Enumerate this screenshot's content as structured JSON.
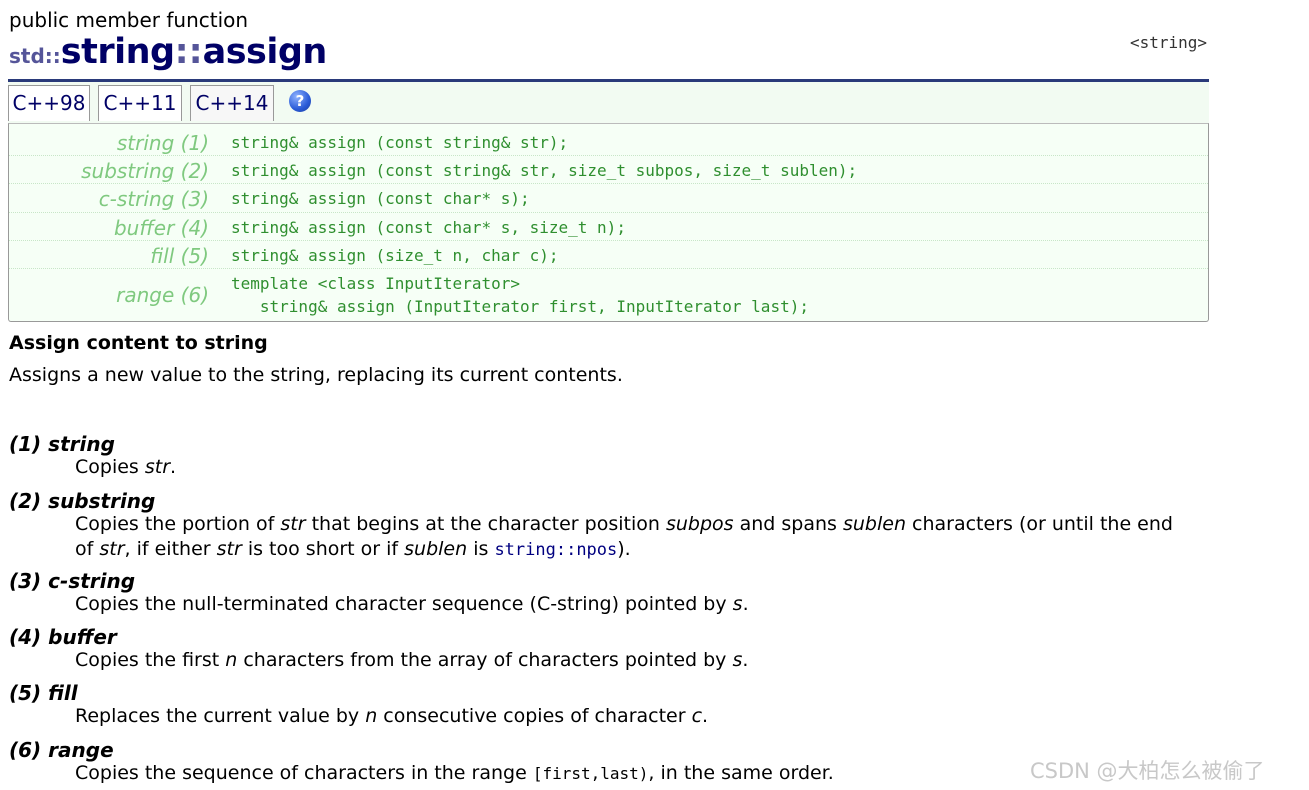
{
  "page": {
    "kind": "public member function",
    "title": {
      "ns": "std::",
      "cls": "string",
      "sep": "::",
      "fn": "assign"
    },
    "header_link": "<string>"
  },
  "tabs": [
    {
      "label": "C++98"
    },
    {
      "label": "C++11"
    },
    {
      "label": "C++14"
    }
  ],
  "help": {
    "glyph": "?"
  },
  "declarations": [
    {
      "label": "string (1)",
      "code": "string& assign (const string& str);"
    },
    {
      "label": "substring (2)",
      "code": "string& assign (const string& str, size_t subpos, size_t sublen);"
    },
    {
      "label": "c-string (3)",
      "code": "string& assign (const char* s);"
    },
    {
      "label": "buffer (4)",
      "code": "string& assign (const char* s, size_t n);"
    },
    {
      "label": "fill (5)",
      "code": "string& assign (size_t n, char c);"
    },
    {
      "label": "range (6)",
      "code": "template <class InputIterator>\n   string& assign (InputIterator first, InputIterator last);"
    }
  ],
  "section": {
    "heading": "Assign content to string",
    "description": "Assigns a new value to the string, replacing its current contents."
  },
  "items": {
    "i1": {
      "head": "(1) string",
      "t1": "Copies ",
      "p1": "str",
      "t2": "."
    },
    "i2": {
      "head": "(2) substring",
      "t1": "Copies the portion of ",
      "p1": "str",
      "t2": " that begins at the character position ",
      "p2": "subpos",
      "t3": " and spans ",
      "p3": "sublen",
      "t4": " characters (or until the end of ",
      "p4": "str",
      "t5": ", if either ",
      "p5": "str",
      "t6": " is too short or if ",
      "p6": "sublen",
      "t7": " is ",
      "link": "string::npos",
      "t8": ")."
    },
    "i3": {
      "head": "(3) c-string",
      "t1": "Copies the null-terminated character sequence (C-string) pointed by ",
      "p1": "s",
      "t2": "."
    },
    "i4": {
      "head": "(4) buffer",
      "t1": "Copies the first ",
      "p1": "n",
      "t2": " characters from the array of characters pointed by ",
      "p2": "s",
      "t3": "."
    },
    "i5": {
      "head": "(5) fill",
      "t1": "Replaces the current value by ",
      "p1": "n",
      "t2": " consecutive copies of character ",
      "p2": "c",
      "t3": "."
    },
    "i6": {
      "head": "(6) range",
      "t1": "Copies the sequence of characters in the range ",
      "code": "[first,last)",
      "t2": ", in the same order."
    }
  },
  "watermark": "CSDN @大柏怎么被偷了"
}
